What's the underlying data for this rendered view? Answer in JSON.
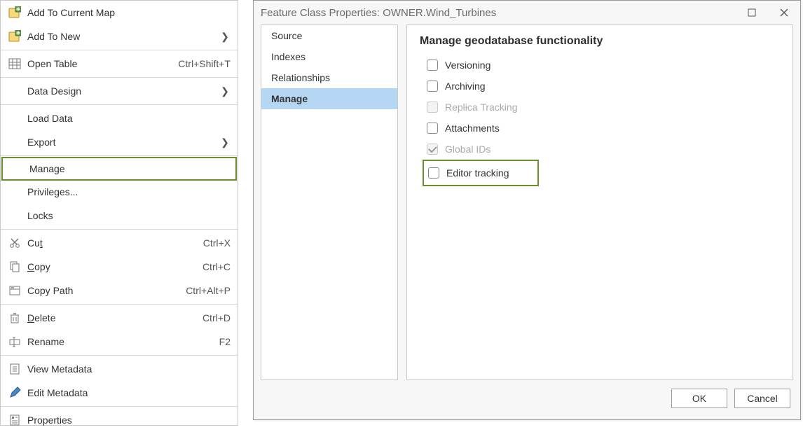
{
  "context_menu": {
    "items": [
      {
        "label": "Add To Current Map",
        "shortcut": "",
        "submenu": false,
        "icon": "add-map-yellow",
        "sep": false
      },
      {
        "label": "Add To New",
        "shortcut": "",
        "submenu": true,
        "icon": "add-map-yellow",
        "sep": false
      },
      {
        "sep": true
      },
      {
        "label": "Open Table",
        "shortcut": "Ctrl+Shift+T",
        "submenu": false,
        "icon": "open-table",
        "sep": false
      },
      {
        "sep": true
      },
      {
        "label": "Data Design",
        "shortcut": "",
        "submenu": true,
        "icon": "",
        "sep": false
      },
      {
        "sep": true
      },
      {
        "label": "Load Data",
        "shortcut": "",
        "submenu": false,
        "icon": "",
        "sep": false
      },
      {
        "label": "Export",
        "shortcut": "",
        "submenu": true,
        "icon": "",
        "sep": false
      },
      {
        "sep": true
      },
      {
        "label": "Manage",
        "shortcut": "",
        "submenu": false,
        "icon": "",
        "highlight": true,
        "sep": false
      },
      {
        "label": "Privileges...",
        "shortcut": "",
        "submenu": false,
        "icon": "",
        "sep": false
      },
      {
        "label": "Locks",
        "shortcut": "",
        "submenu": false,
        "icon": "",
        "sep": false
      },
      {
        "sep": true
      },
      {
        "label": "Cut",
        "underline": "t",
        "base": "Cu",
        "shortcut": "Ctrl+X",
        "submenu": false,
        "icon": "scissors",
        "sep": false
      },
      {
        "label": "Copy",
        "underline": "C",
        "rest": "opy",
        "shortcut": "Ctrl+C",
        "submenu": false,
        "icon": "copy",
        "sep": false
      },
      {
        "label": "Copy Path",
        "shortcut": "Ctrl+Alt+P",
        "submenu": false,
        "icon": "copy-path",
        "sep": false
      },
      {
        "sep": true
      },
      {
        "label": "Delete",
        "underline": "D",
        "rest": "elete",
        "shortcut": "Ctrl+D",
        "submenu": false,
        "icon": "delete",
        "sep": false
      },
      {
        "label": "Rename",
        "shortcut": "F2",
        "submenu": false,
        "icon": "rename",
        "sep": false
      },
      {
        "sep": true
      },
      {
        "label": "View Metadata",
        "shortcut": "",
        "submenu": false,
        "icon": "view-metadata",
        "sep": false
      },
      {
        "label": "Edit Metadata",
        "shortcut": "",
        "submenu": false,
        "icon": "edit-metadata",
        "sep": false
      },
      {
        "sep": true
      },
      {
        "label": "Properties",
        "shortcut": "",
        "submenu": false,
        "icon": "properties",
        "sep": false
      }
    ]
  },
  "dialog": {
    "title": "Feature Class Properties: OWNER.Wind_Turbines",
    "tabs": [
      "Source",
      "Indexes",
      "Relationships",
      "Manage"
    ],
    "selected_tab": "Manage",
    "content": {
      "heading": "Manage geodatabase functionality",
      "checkboxes": [
        {
          "label": "Versioning",
          "checked": false,
          "disabled": false
        },
        {
          "label": "Archiving",
          "checked": false,
          "disabled": false
        },
        {
          "label": "Replica Tracking",
          "checked": false,
          "disabled": true
        },
        {
          "label": "Attachments",
          "checked": false,
          "disabled": false
        },
        {
          "label": "Global IDs",
          "checked": true,
          "disabled": true
        },
        {
          "label": "Editor tracking",
          "checked": false,
          "disabled": false,
          "highlight": true
        }
      ]
    },
    "buttons": {
      "ok": "OK",
      "cancel": "Cancel"
    }
  }
}
